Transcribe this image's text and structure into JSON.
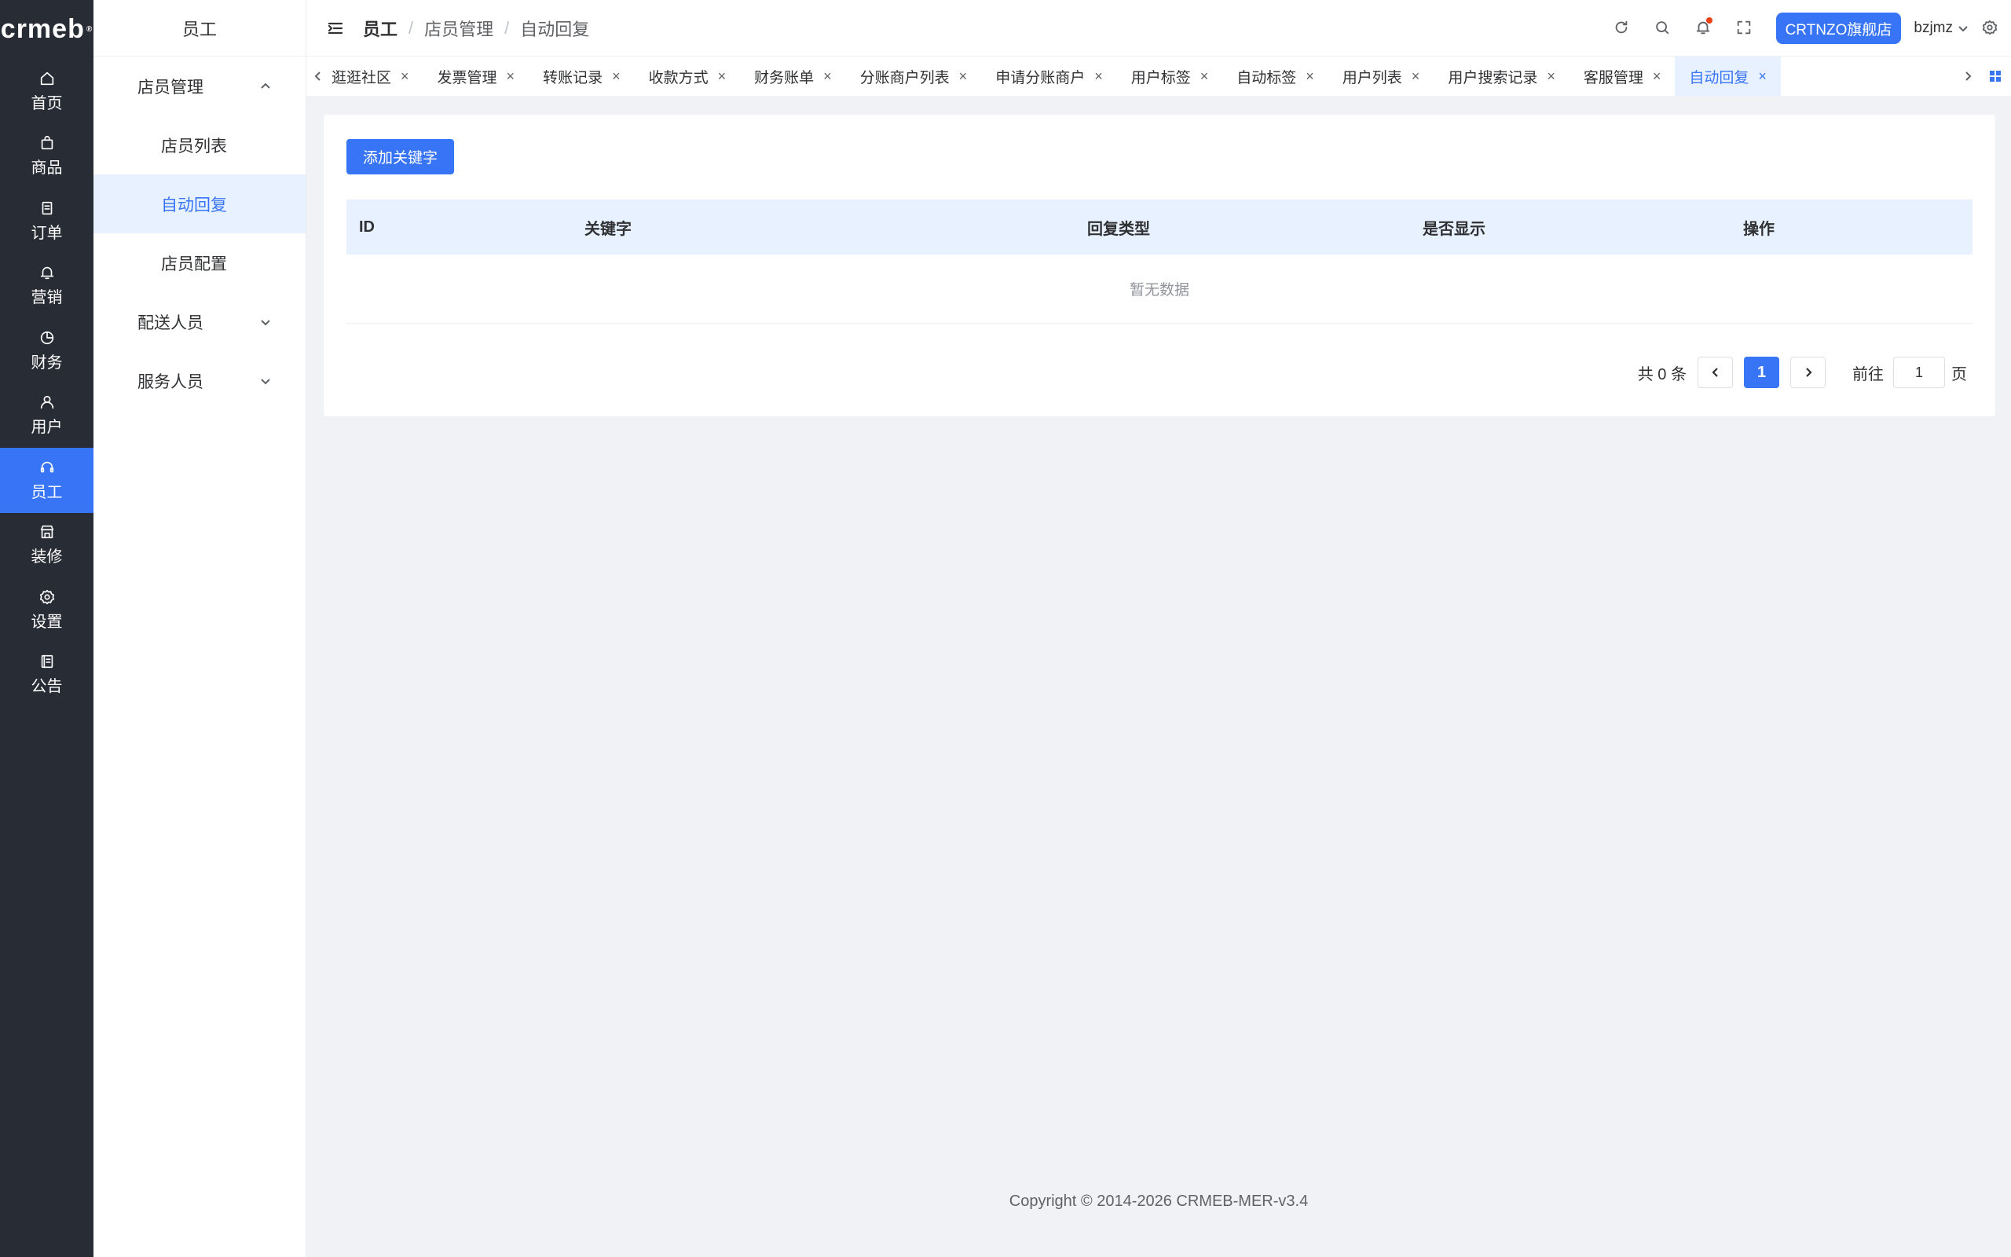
{
  "brand": {
    "logo_text": "crmeb",
    "logo_mark": "®"
  },
  "rail": [
    {
      "label": "首页",
      "icon": "home-icon"
    },
    {
      "label": "商品",
      "icon": "bag-icon"
    },
    {
      "label": "订单",
      "icon": "document-icon"
    },
    {
      "label": "营销",
      "icon": "bell-icon"
    },
    {
      "label": "财务",
      "icon": "pie-chart-icon"
    },
    {
      "label": "用户",
      "icon": "user-icon"
    },
    {
      "label": "员工",
      "icon": "headset-icon",
      "active": true
    },
    {
      "label": "装修",
      "icon": "shop-icon"
    },
    {
      "label": "设置",
      "icon": "gear-icon"
    },
    {
      "label": "公告",
      "icon": "notice-icon"
    }
  ],
  "submenu": {
    "title": "员工",
    "groups": [
      {
        "label": "店员管理",
        "expanded": true,
        "items": [
          "店员列表",
          "自动回复",
          "店员配置"
        ],
        "active_item": "自动回复"
      },
      {
        "label": "配送人员",
        "expanded": false
      },
      {
        "label": "服务人员",
        "expanded": false
      }
    ]
  },
  "header": {
    "breadcrumb": [
      "员工",
      "店员管理",
      "自动回复"
    ],
    "store_button": "CRTNZO旗舰店",
    "username": "bzjmz"
  },
  "tabs": {
    "items": [
      "逛逛社区",
      "发票管理",
      "转账记录",
      "收款方式",
      "财务账单",
      "分账商户列表",
      "申请分账商户",
      "用户标签",
      "自动标签",
      "用户列表",
      "用户搜索记录",
      "客服管理",
      "自动回复"
    ],
    "active": "自动回复",
    "close_glyph": "×"
  },
  "main": {
    "add_button": "添加关键字",
    "table": {
      "columns": [
        "ID",
        "关键字",
        "回复类型",
        "是否显示",
        "操作"
      ],
      "empty_text": "暂无数据"
    },
    "pagination": {
      "total_text": "共 0 条",
      "current_page": "1",
      "goto_prefix": "前往",
      "goto_value": "1",
      "goto_suffix": "页"
    }
  },
  "footer": {
    "copyright": "Copyright © 2014-2026 CRMEB-MER-v3.4"
  },
  "colors": {
    "primary": "#3875f6",
    "rail_bg": "#282c34",
    "active_bg": "#e8f1ff"
  }
}
